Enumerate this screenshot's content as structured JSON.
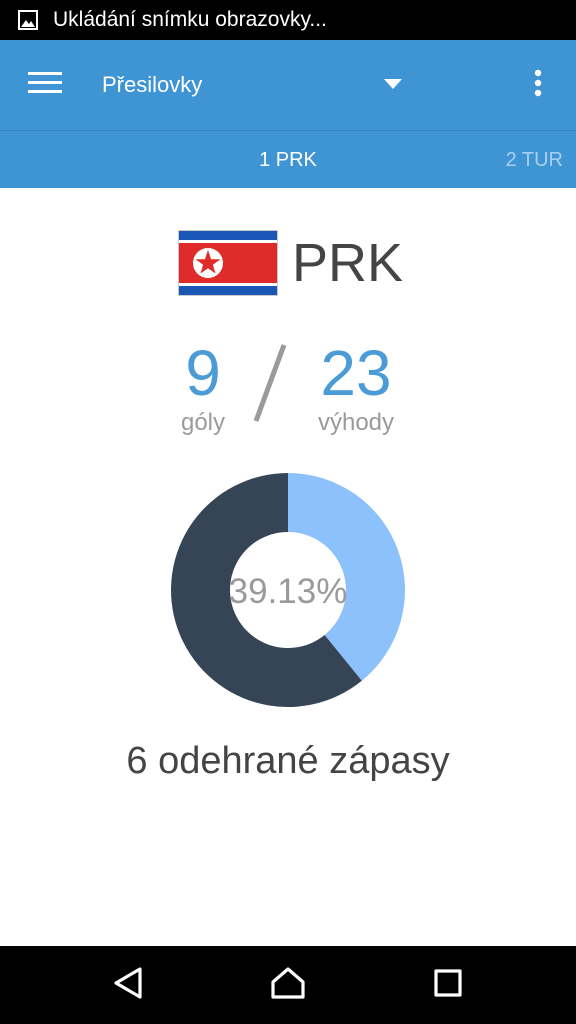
{
  "status_bar": {
    "notification_text": "Ukládání snímku obrazovky...",
    "icon": "image-icon"
  },
  "toolbar": {
    "menu_icon": "hamburger-menu-icon",
    "selected_option": "Přesilovky",
    "dropdown_icon": "dropdown-arrow-icon",
    "more_icon": "overflow-menu-icon",
    "background_color": "#3f95d4"
  },
  "tabs": [
    {
      "label": "1 PRK",
      "active": true
    },
    {
      "label": "2 TUR",
      "active": false
    }
  ],
  "team": {
    "name": "PRK",
    "flag": "north-korea-flag"
  },
  "stats": {
    "goals_value": "9",
    "goals_label": "góly",
    "separator": "/",
    "advantages_value": "23",
    "advantages_label": "výhody",
    "accent_color": "#4a9bd6"
  },
  "chart_data": {
    "type": "pie",
    "donut": true,
    "center_label": "39.13%",
    "slices": [
      {
        "value": 39.13,
        "color": "#8cc1fb"
      },
      {
        "value": 60.87,
        "color": "#364555"
      }
    ]
  },
  "matches_played": "6 odehrané zápasy",
  "nav_bar": {
    "back_icon": "back-triangle-icon",
    "home_icon": "home-icon",
    "recent_icon": "recent-apps-icon"
  }
}
